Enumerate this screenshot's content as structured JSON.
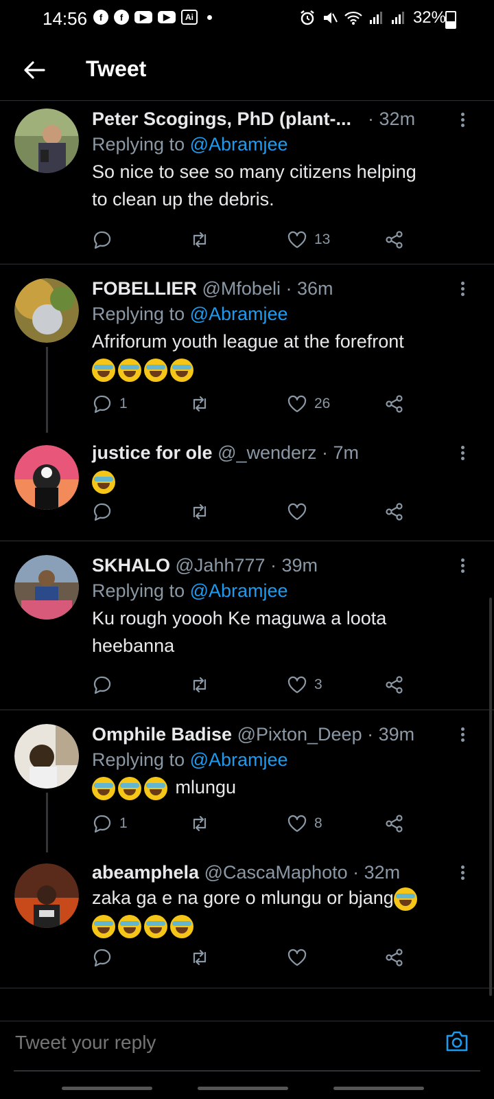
{
  "status_bar": {
    "time": "14:56",
    "battery": "32%",
    "app_icons": [
      "facebook-icon",
      "facebook-icon",
      "youtube-icon",
      "youtube-icon",
      "ai-icon"
    ],
    "ai_label": "Ai"
  },
  "header": {
    "title": "Tweet"
  },
  "tweets": [
    {
      "name": "Peter Scogings, PhD (plant-...",
      "handle": "",
      "time": "· 32m",
      "replying_prefix": "Replying to ",
      "replying_to": "@Abramjee",
      "text_lines": [
        "So nice to see so many citizens helping",
        "to clean up the debris."
      ],
      "replies": "",
      "likes": "13"
    },
    {
      "name": "FOBELLIER",
      "handle": "@Mfobeli · 36m",
      "time": "",
      "replying_prefix": "Replying to ",
      "replying_to": "@Abramjee",
      "text_lines": [
        "Afriforum youth league at the forefront"
      ],
      "emoji_count": 4,
      "replies": "1",
      "likes": "26"
    },
    {
      "name": "justice for ole",
      "handle": "@_wenderz · 7m",
      "time": "",
      "replying_prefix": "",
      "replying_to": "",
      "text_lines": [],
      "emoji_count": 1,
      "replies": "",
      "likes": ""
    },
    {
      "name": "SKHALO",
      "handle": "@Jahh777 · 39m",
      "time": "",
      "replying_prefix": "Replying to ",
      "replying_to": "@Abramjee",
      "text_lines": [
        "Ku rough yoooh Ke maguwa a loota",
        "heebanna"
      ],
      "replies": "",
      "likes": "3"
    },
    {
      "name": "Omphile Badise",
      "handle": "@Pixton_Deep · 39m",
      "time": "",
      "replying_prefix": "Replying to ",
      "replying_to": "@Abramjee",
      "text_after_emoji": "mlungu",
      "emoji_count": 3,
      "replies": "1",
      "likes": "8"
    },
    {
      "name": "abeamphela",
      "handle": "@CascaMaphoto · 32m",
      "time": "",
      "replying_prefix": "",
      "replying_to": "",
      "text_lines": [
        "zaka ga e na gore o mlungu or bjang"
      ],
      "emoji_count": 4,
      "replies": "",
      "likes": ""
    }
  ],
  "composer": {
    "placeholder": "Tweet your reply"
  },
  "colors": {
    "accent": "#1d9bf0",
    "muted": "#8b98a5",
    "background": "#000000"
  }
}
